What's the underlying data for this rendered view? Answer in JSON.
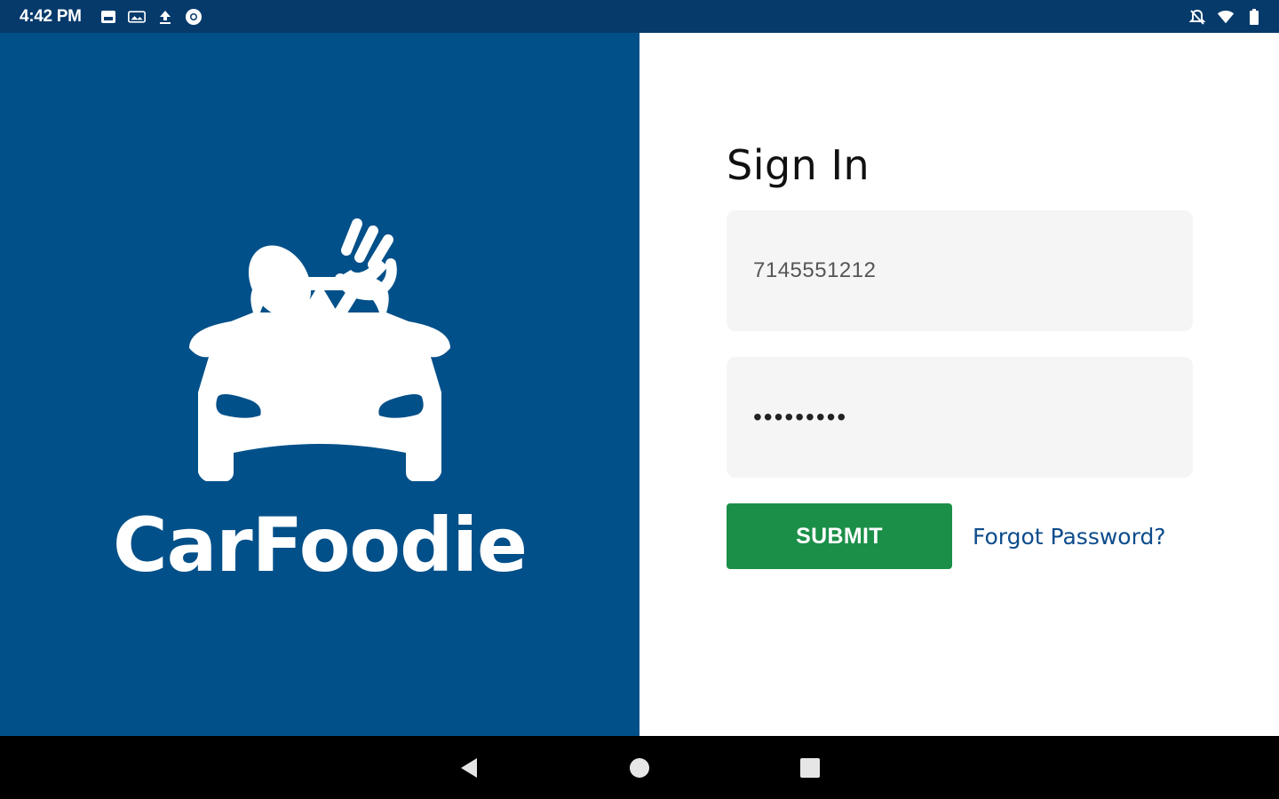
{
  "status_bar": {
    "time": "4:42 PM",
    "left_icons": [
      "gallery-icon",
      "photo-icon",
      "upload-icon",
      "chrome-icon"
    ],
    "right_icons": [
      "notifications-off-icon",
      "wifi-icon",
      "battery-icon"
    ]
  },
  "brand": {
    "name": "CarFoodie",
    "logo_icon": "car-with-spoon-and-fork-icon",
    "background_color": "#025089"
  },
  "signin": {
    "title": "Sign In",
    "phone_value": "7145551212",
    "password_value": "•••••••••",
    "submit_label": "SUBMIT",
    "forgot_label": "Forgot Password?",
    "submit_color": "#1b8f48",
    "link_color": "#0d4c8c"
  },
  "nav_bar": {
    "buttons": [
      "back-icon",
      "home-icon",
      "recents-icon"
    ]
  }
}
